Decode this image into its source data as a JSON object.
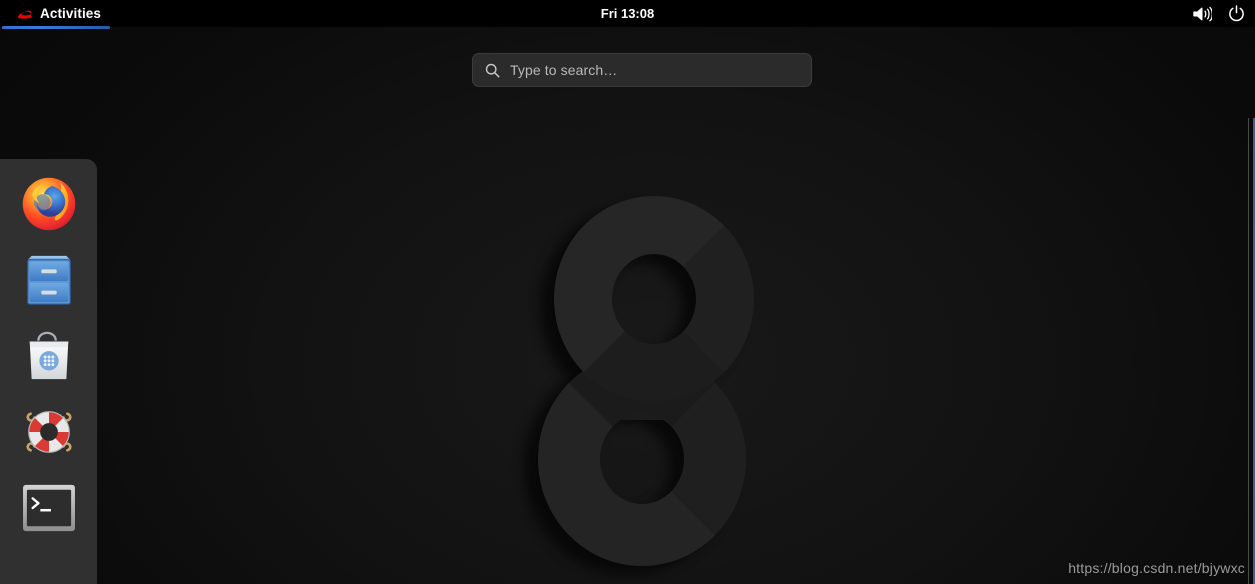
{
  "topbar": {
    "activities_label": "Activities",
    "activities_icon": "redhat-logo-icon",
    "clock": "Fri 13:08",
    "status_icons": [
      {
        "name": "volume-icon",
        "label": "Volume"
      },
      {
        "name": "power-icon",
        "label": "Power"
      }
    ],
    "accent_color": "#3a7bdc"
  },
  "search": {
    "placeholder": "Type to search…",
    "value": "",
    "icon": "search-icon"
  },
  "dock": {
    "items": [
      {
        "name": "firefox",
        "label": "Firefox"
      },
      {
        "name": "files",
        "label": "Files"
      },
      {
        "name": "software",
        "label": "Software"
      },
      {
        "name": "help",
        "label": "Help"
      },
      {
        "name": "terminal",
        "label": "Terminal"
      }
    ]
  },
  "desktop": {
    "wallpaper_label": "8",
    "background_color": "#0a0a0a"
  },
  "watermark": {
    "text": "https://blog.csdn.net/bjywxc"
  }
}
